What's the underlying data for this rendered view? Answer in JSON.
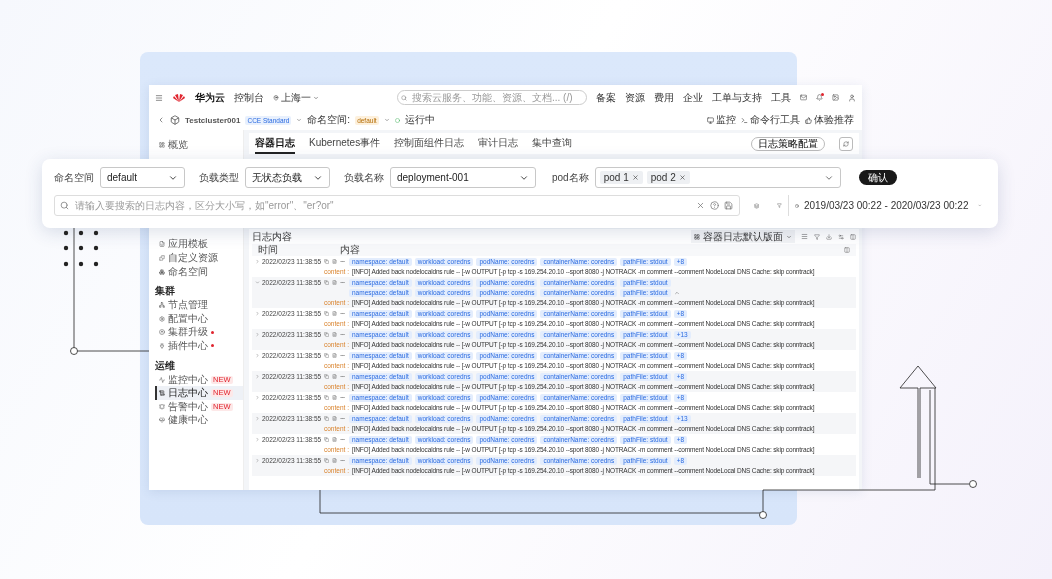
{
  "topbar": {
    "brand": "华为云",
    "console": "控制台",
    "region": "上海一",
    "search": {
      "placeholder": "搜索云服务、功能、资源、文档... (/)"
    },
    "links": [
      "备案",
      "资源",
      "费用",
      "企业",
      "工单与支持",
      "工具"
    ]
  },
  "cluster_bar": {
    "name": "Testcluster001",
    "edition": "CCE Standard",
    "namespace_label": "命名空间:",
    "namespace": "default",
    "status": "运行中",
    "actions": [
      "监控",
      "命令行工具",
      "体验推荐"
    ]
  },
  "sidebar": {
    "top": [
      {
        "label": "概览",
        "selected": false
      }
    ],
    "sections": [
      {
        "items": [
          {
            "label": "应用模板",
            "selected": false
          },
          {
            "label": "自定义资源",
            "selected": false
          },
          {
            "label": "命名空间",
            "selected": false
          }
        ]
      },
      {
        "title": "集群",
        "items": [
          {
            "label": "节点管理",
            "selected": false
          },
          {
            "label": "配置中心",
            "selected": false
          },
          {
            "label": "集群升级",
            "alert": true,
            "selected": false
          },
          {
            "label": "插件中心",
            "alert": true,
            "selected": false
          }
        ]
      },
      {
        "title": "运维",
        "items": [
          {
            "label": "监控中心",
            "badge": "NEW",
            "selected": false
          },
          {
            "label": "日志中心",
            "badge": "NEW",
            "selected": true
          },
          {
            "label": "告警中心",
            "badge": "NEW",
            "selected": false
          },
          {
            "label": "健康中心",
            "selected": false
          }
        ]
      }
    ]
  },
  "tabs": [
    {
      "label": "容器日志",
      "selected": true
    },
    {
      "label": "Kubernetes事件",
      "selected": false
    },
    {
      "label": "控制面组件日志",
      "selected": false
    },
    {
      "label": "审计日志",
      "selected": false
    },
    {
      "label": "集中查询",
      "selected": false
    }
  ],
  "policy_button": "日志策略配置",
  "filters": {
    "namespace": {
      "label": "命名空间",
      "value": "default"
    },
    "workload_type": {
      "label": "负载类型",
      "value": "无状态负载"
    },
    "workload_name": {
      "label": "负载名称",
      "value": "deployment-001"
    },
    "pods": {
      "label": "pod名称",
      "chips": [
        "pod 1",
        "pod 2"
      ]
    },
    "confirm": "确认",
    "search": {
      "placeholder": "请输入要搜索的日志内容，区分大小写，如\"error\"、\"er?or\""
    },
    "time_range": "2019/03/23 00:22 - 2020/03/23 00:22"
  },
  "log_panel": {
    "title": "日志内容",
    "layout": "容器日志默认版面",
    "columns": [
      "时间",
      "内容"
    ],
    "rows": [
      {
        "time": "2022/02/23 11:38:55",
        "expanded": false,
        "tag_rows": [
          [
            "namespace: default",
            "workload: coredns",
            "podName: coredns",
            "containerName: coredns",
            "pathFile: stdout"
          ]
        ],
        "more": "+8",
        "content_label": "content :",
        "content": "[INFO] Added back nodelocaldns rule -- [-w OUTPUT [-p tcp -s 169.254.20.10 --sport 8080 -j NOTRACK -m comment --comment NodeLocal DNS Cache: skip conntrack]"
      },
      {
        "time": "2022/02/23 11:38:55",
        "expanded": true,
        "tag_rows": [
          [
            "namespace: default",
            "workload: coredns",
            "podName: coredns",
            "containerName: coredns",
            "pathFile: stdout"
          ],
          [
            "namespace: default",
            "workload: coredns",
            "podName: coredns",
            "containerName: coredns",
            "pathFile: stdout"
          ]
        ],
        "content_label": "content :",
        "content": "[INFO] Added back nodelocaldns rule -- [-w OUTPUT [-p tcp -s 169.254.20.10 --sport 8080 -j NOTRACK -m comment --comment NodeLocal DNS Cache: skip conntrack]"
      },
      {
        "time": "2022/02/23 11:38:55",
        "expanded": false,
        "tag_rows": [
          [
            "namespace: default",
            "workload: coredns",
            "podName: coredns",
            "containerName: coredns",
            "pathFile: stdout"
          ]
        ],
        "more": "+8",
        "content_label": "content :",
        "content": "[INFO] Added back nodelocaldns rule -- [-w OUTPUT [-p tcp -s 169.254.20.10 --sport 8080 -j NOTRACK -m comment --comment NodeLocal DNS Cache: skip conntrack]"
      },
      {
        "time": "2022/02/23 11:38:55",
        "expanded": false,
        "tag_rows": [
          [
            "namespace: default",
            "workload: coredns",
            "podName: coredns",
            "containerName: coredns",
            "pathFile: stdout"
          ]
        ],
        "more": "+13",
        "content_label": "content :",
        "content": "[INFO] Added back nodelocaldns rule -- [-w OUTPUT [-p tcp -s 169.254.20.10 --sport 8080 -j NOTRACK -m comment --comment NodeLocal DNS Cache: skip conntrack]"
      },
      {
        "time": "2022/02/23 11:38:55",
        "expanded": false,
        "tag_rows": [
          [
            "namespace: default",
            "workload: coredns",
            "podName: coredns",
            "containerName: coredns",
            "pathFile: stdout"
          ]
        ],
        "more": "+8",
        "content_label": "content :",
        "content": "[INFO] Added back nodelocaldns rule -- [-w OUTPUT [-p tcp -s 169.254.20.10 --sport 8080 -j NOTRACK -m comment --comment NodeLocal DNS Cache: skip conntrack]"
      },
      {
        "time": "2022/02/23 11:38:55",
        "expanded": false,
        "tag_rows": [
          [
            "namespace: default",
            "workload: coredns",
            "podName: coredns",
            "containerName: coredns",
            "pathFile: stdout"
          ]
        ],
        "more": "+8",
        "content_label": "content :",
        "content": "[INFO] Added back nodelocaldns rule -- [-w OUTPUT [-p tcp -s 169.254.20.10 --sport 8080 -j NOTRACK -m comment --comment NodeLocal DNS Cache: skip conntrack]"
      },
      {
        "time": "2022/02/23 11:38:55",
        "expanded": false,
        "tag_rows": [
          [
            "namespace: default",
            "workload: coredns",
            "podName: coredns",
            "containerName: coredns",
            "pathFile: stdout"
          ]
        ],
        "more": "+8",
        "content_label": "content :",
        "content": "[INFO] Added back nodelocaldns rule -- [-w OUTPUT [-p tcp -s 169.254.20.10 --sport 8080 -j NOTRACK -m comment --comment NodeLocal DNS Cache: skip conntrack]"
      },
      {
        "time": "2022/02/23 11:38:55",
        "expanded": false,
        "tag_rows": [
          [
            "namespace: default",
            "workload: coredns",
            "podName: coredns",
            "containerName: coredns",
            "pathFile: stdout"
          ]
        ],
        "more": "+13",
        "content_label": "content :",
        "content": "[INFO] Added back nodelocaldns rule -- [-w OUTPUT [-p tcp -s 169.254.20.10 --sport 8080 -j NOTRACK -m comment --comment NodeLocal DNS Cache: skip conntrack]"
      },
      {
        "time": "2022/02/23 11:38:55",
        "expanded": false,
        "tag_rows": [
          [
            "namespace: default",
            "workload: coredns",
            "podName: coredns",
            "containerName: coredns",
            "pathFile: stdout"
          ]
        ],
        "more": "+8",
        "content_label": "content :",
        "content": "[INFO] Added back nodelocaldns rule -- [-w OUTPUT [-p tcp -s 169.254.20.10 --sport 8080 -j NOTRACK -m comment --comment NodeLocal DNS Cache: skip conntrack]"
      },
      {
        "time": "2022/02/23 11:38:55",
        "expanded": false,
        "tag_rows": [
          [
            "namespace: default",
            "workload: coredns",
            "podName: coredns",
            "containerName: coredns",
            "pathFile: stdout"
          ]
        ],
        "more": "+8",
        "content_label": "content :",
        "content": "[INFO] Added back nodelocaldns rule -- [-w OUTPUT [-p tcp -s 169.254.20.10 --sport 8080 -j NOTRACK -m comment --comment NodeLocal DNS Cache: skip conntrack]"
      }
    ]
  }
}
